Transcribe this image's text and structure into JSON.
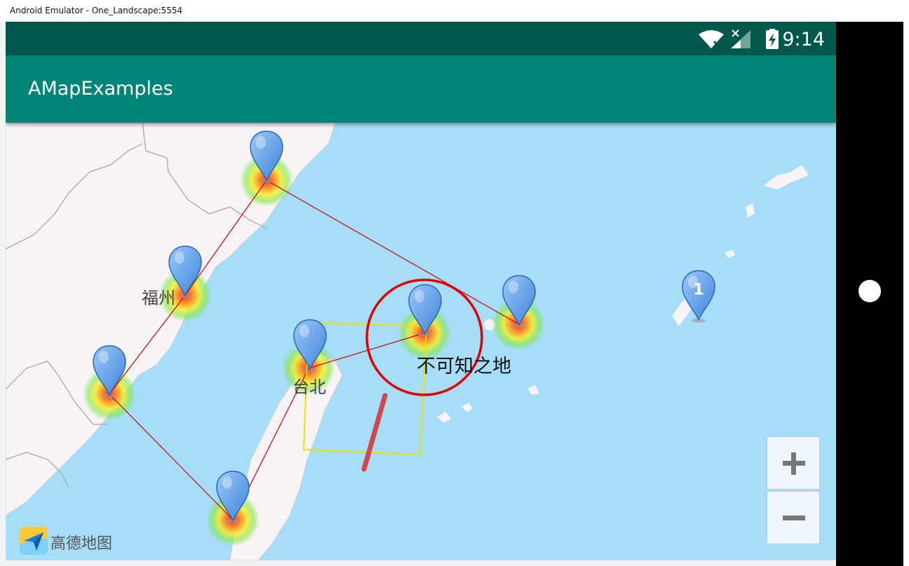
{
  "window": {
    "title": "Android Emulator - One_Landscape:5554"
  },
  "status_bar": {
    "time": "9:14",
    "icons": [
      "wifi-icon",
      "no-signal-icon",
      "battery-charging-icon"
    ]
  },
  "app_bar": {
    "title": "AMapExamples"
  },
  "map": {
    "labels": {
      "fuzhou": "福州",
      "taipei": "台北",
      "unknown_land": "不可知之地"
    },
    "cluster_marker": {
      "count": "1"
    },
    "logo_text": "高德地图",
    "zoom": {
      "in_label": "+",
      "out_label": "−"
    }
  },
  "colors": {
    "status_bar": "#00574b",
    "app_bar": "#008577",
    "water": "#a6ddf8",
    "land": "#f8f3f5",
    "polyline": "#d40000",
    "circle": "#e00000",
    "polygon": "#f0e000",
    "thick_line": "#d04848",
    "marker": "#5b9ee8"
  }
}
